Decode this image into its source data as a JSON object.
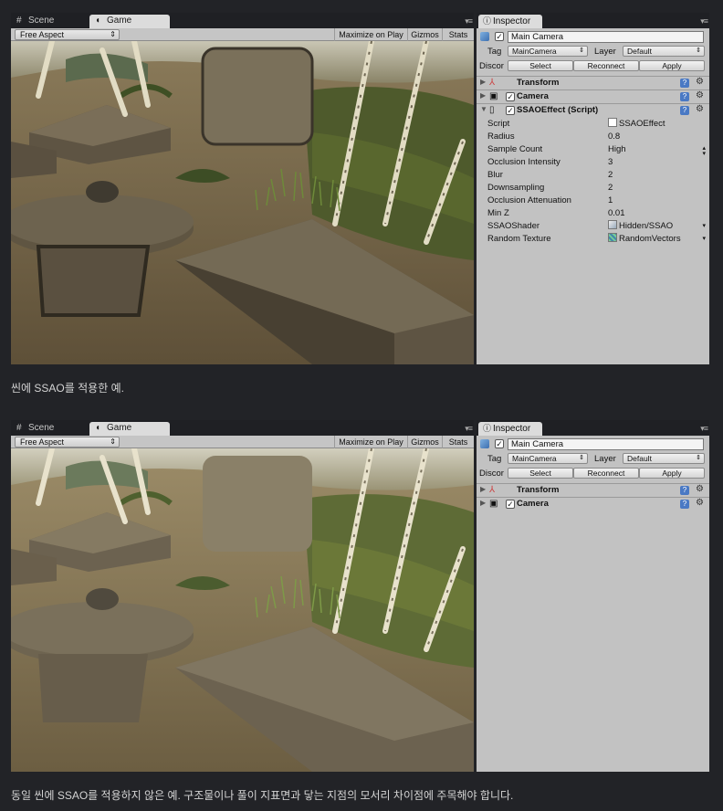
{
  "shots": [
    {
      "tabs": {
        "scene": "Scene",
        "game": "Game"
      },
      "aspect": "Free Aspect",
      "toolbar": {
        "maximize": "Maximize on Play",
        "gizmos": "Gizmos",
        "stats": "Stats"
      },
      "inspector": {
        "tab": "Inspector",
        "object_name": "Main Camera",
        "tag_label": "Tag",
        "tag_value": "MainCamera",
        "layer_label": "Layer",
        "layer_value": "Default",
        "disconnect_label": "Discor",
        "select": "Select",
        "reconnect": "Reconnect",
        "apply": "Apply",
        "components": [
          "Transform",
          "Camera",
          "SSAOEffect (Script)"
        ],
        "properties": [
          {
            "name": "Script",
            "value": "SSAOEffect"
          },
          {
            "name": "Radius",
            "value": "0.8"
          },
          {
            "name": "Sample Count",
            "value": "High"
          },
          {
            "name": "Occlusion Intensity",
            "value": "3"
          },
          {
            "name": "Blur",
            "value": "2"
          },
          {
            "name": "Downsampling",
            "value": "2"
          },
          {
            "name": "Occlusion Attenuation",
            "value": "1"
          },
          {
            "name": "Min Z",
            "value": "0.01"
          },
          {
            "name": "SSAOShader",
            "value": "Hidden/SSAO"
          },
          {
            "name": "Random Texture",
            "value": "RandomVectors"
          }
        ]
      }
    },
    {
      "tabs": {
        "scene": "Scene",
        "game": "Game"
      },
      "aspect": "Free Aspect",
      "toolbar": {
        "maximize": "Maximize on Play",
        "gizmos": "Gizmos",
        "stats": "Stats"
      },
      "inspector": {
        "tab": "Inspector",
        "object_name": "Main Camera",
        "tag_label": "Tag",
        "tag_value": "MainCamera",
        "layer_label": "Layer",
        "layer_value": "Default",
        "disconnect_label": "Discor",
        "select": "Select",
        "reconnect": "Reconnect",
        "apply": "Apply",
        "components": [
          "Transform",
          "Camera"
        ]
      }
    }
  ],
  "captions": [
    "씬에 SSAO를 적용한 예.",
    "동일 씬에 SSAO를 적용하지 않은 예. 구조물이나 풀이 지표면과 닿는 지점의 모서리 차이점에 주목해야 합니다."
  ],
  "colors": {
    "page_bg": "#222327",
    "inspector_bg": "#c2c2c2",
    "help_icon": "#4a79c4"
  }
}
